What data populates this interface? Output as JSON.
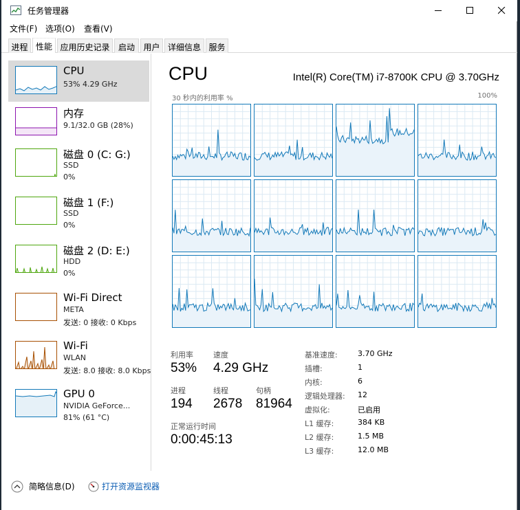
{
  "window": {
    "title": "任务管理器"
  },
  "menu": [
    "文件(F)",
    "选项(O)",
    "查看(V)"
  ],
  "tabs": [
    "进程",
    "性能",
    "应用历史记录",
    "启动",
    "用户",
    "详细信息",
    "服务"
  ],
  "active_tab": "性能",
  "sidebar": [
    {
      "name": "CPU",
      "line1": "53%  4.29 GHz",
      "line2": ""
    },
    {
      "name": "内存",
      "line1": "9.1/32.0 GB (28%)",
      "line2": ""
    },
    {
      "name": "磁盘 0 (C: G:)",
      "line1": "SSD",
      "line2": "0%"
    },
    {
      "name": "磁盘 1 (F:)",
      "line1": "SSD",
      "line2": "0%"
    },
    {
      "name": "磁盘 2 (D: E:)",
      "line1": "HDD",
      "line2": "0%"
    },
    {
      "name": "Wi-Fi Direct",
      "line1": "META",
      "line2": "发送: 0 接收: 0 Kbps"
    },
    {
      "name": "Wi-Fi",
      "line1": "WLAN",
      "line2": "发送: 8.0  接收: 8.0 Kbps"
    },
    {
      "name": "GPU 0",
      "line1": "NVIDIA GeForce...",
      "line2": "81% (61 °C)"
    }
  ],
  "main": {
    "title": "CPU",
    "model": "Intel(R) Core(TM) i7-8700K CPU @ 3.70GHz",
    "graph_caption": "30 秒内的利用率 %",
    "graph_max": "100%",
    "stats": {
      "util_label": "利用率",
      "util_value": "53%",
      "speed_label": "速度",
      "speed_value": "4.29 GHz",
      "proc_label": "进程",
      "proc_value": "194",
      "thread_label": "线程",
      "thread_value": "2678",
      "handle_label": "句柄",
      "handle_value": "81964",
      "uptime_label": "正常运行时间",
      "uptime_value": "0:00:45:13"
    },
    "details": [
      {
        "label": "基准速度:",
        "value": "3.70 GHz"
      },
      {
        "label": "插槽:",
        "value": "1"
      },
      {
        "label": "内核:",
        "value": "6"
      },
      {
        "label": "逻辑处理器:",
        "value": "12"
      },
      {
        "label": "虚拟化:",
        "value": "已启用"
      },
      {
        "label": "L1 缓存:",
        "value": "384 KB"
      },
      {
        "label": "L2 缓存:",
        "value": "1.5 MB"
      },
      {
        "label": "L3 缓存:",
        "value": "12.0 MB"
      }
    ]
  },
  "footer": {
    "less_details": "简略信息(D)",
    "open_monitor": "打开资源监视器"
  },
  "colors": {
    "cpu": "#1178b8",
    "memory": "#8b12ae",
    "disk": "#4da60c",
    "wifi_direct": "#a74f01",
    "wifi": "#a74f01",
    "gpu": "#1178b8"
  }
}
